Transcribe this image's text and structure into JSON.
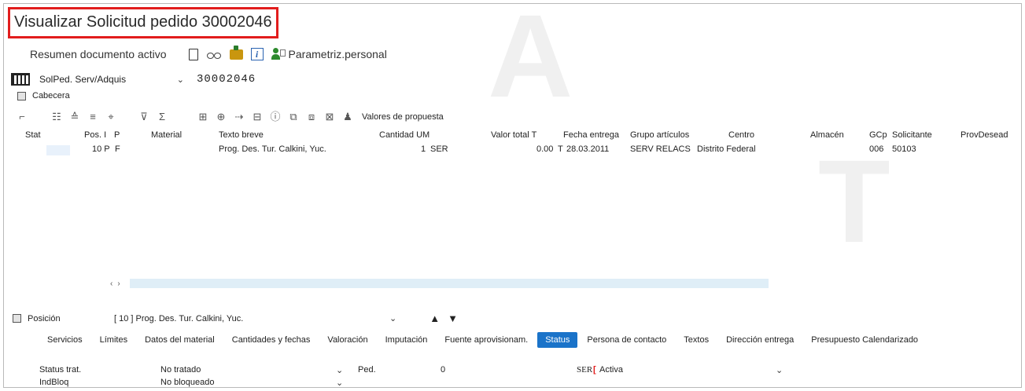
{
  "window": {
    "title": "Visualizar Solicitud pedido 30002046"
  },
  "toolbar": {
    "summary_label": "Resumen documento activo",
    "personal_label": "Parametriz.personal"
  },
  "document": {
    "type_label": "SolPed. Serv/Adquis",
    "number": "30002046"
  },
  "header_section": {
    "label": "Cabecera"
  },
  "grid_toolbar": {
    "default_values_label": "Valores de propuesta"
  },
  "table": {
    "columns": [
      "Stat",
      "Pos. I",
      "P",
      "Material",
      "Texto breve",
      "Cantidad UM",
      "Valor total T",
      "Fecha entrega",
      "Grupo artículos",
      "Centro",
      "Almacén",
      "GCp",
      "Solicitante",
      "ProvDesead"
    ],
    "rows": [
      {
        "pos": "10 P",
        "type": "F",
        "material": "",
        "text": "Prog. Des. Tur. Calkini, Yuc.",
        "qty": "1",
        "um": "SER",
        "value": "0.00",
        "t": "T",
        "date": "28.03.2011",
        "group": "SERV RELACS",
        "center": "Distrito Federal",
        "gcp": "006",
        "requester": "50103"
      }
    ]
  },
  "position": {
    "label": "Posición",
    "value": "[ 10 ] Prog. Des. Tur. Calkini, Yuc."
  },
  "tabs": [
    "Servicios",
    "Límites",
    "Datos del material",
    "Cantidades y fechas",
    "Valoración",
    "Imputación",
    "Fuente aprovisionam.",
    "Status",
    "Persona de contacto",
    "Textos",
    "Dirección entrega",
    "Presupuesto Calendarizado"
  ],
  "active_tab": "Status",
  "status_fields": {
    "status_label": "Status trat.",
    "status_value": "No tratado",
    "ped_label": "Ped.",
    "ped_value": "0",
    "unit": "SER",
    "state": "Activa",
    "block_label": "IndBloq",
    "block_value": "No bloqueado"
  },
  "watermark": [
    "A",
    "T"
  ],
  "colors": {
    "highlight_border": "#e21d1d",
    "active_tab": "#1a73c9"
  }
}
